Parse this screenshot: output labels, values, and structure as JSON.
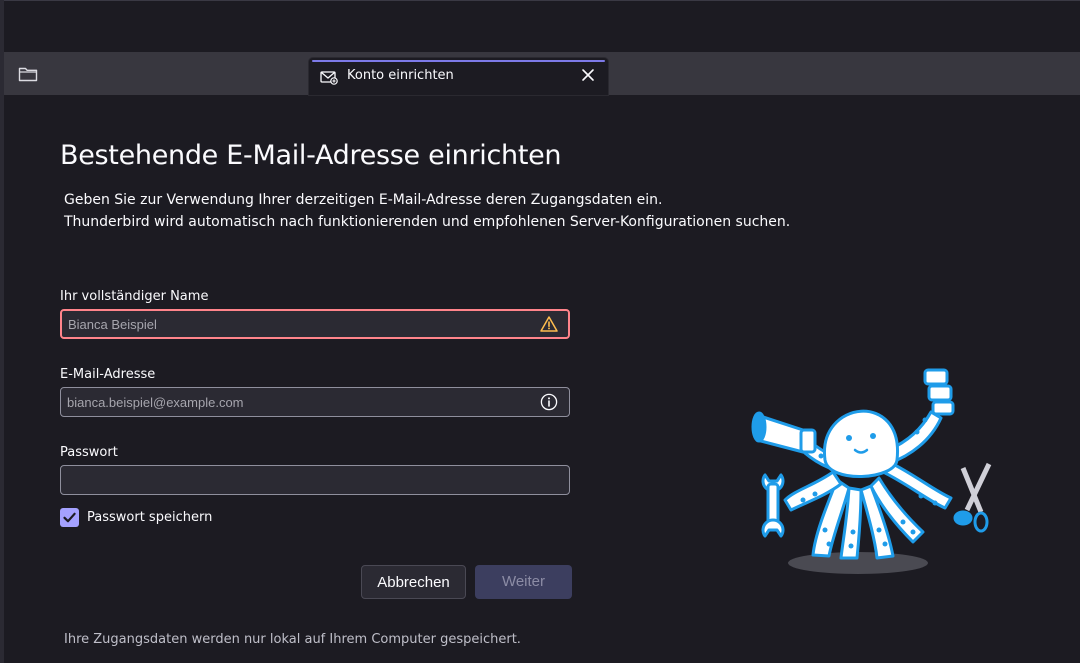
{
  "window": {
    "tab": {
      "label": "Konto einrichten",
      "icon": "mail-setup-icon",
      "accent_color": "#7d7ae8"
    },
    "folder_icon": "folder-icon"
  },
  "page": {
    "title": "Bestehende E-Mail-Adresse einrichten",
    "intro_line1": "Geben Sie zur Verwendung Ihrer derzeitigen E-Mail-Adresse deren Zugangsdaten ein.",
    "intro_line2": "Thunderbird wird automatisch nach funktionierenden und empfohlenen Server-Konfigurationen suchen."
  },
  "form": {
    "name": {
      "label": "Ihr vollständiger Name",
      "placeholder": "Bianca Beispiel",
      "value": "",
      "status_icon": "warning-icon",
      "status_color": "#ff848b"
    },
    "email": {
      "label": "E-Mail-Adresse",
      "placeholder": "bianca.beispiel@example.com",
      "value": "",
      "status_icon": "info-icon"
    },
    "password": {
      "label": "Passwort",
      "placeholder": "",
      "value": ""
    },
    "remember_password": {
      "label": "Passwort speichern",
      "checked": true
    }
  },
  "buttons": {
    "cancel": "Abbrechen",
    "next": "Weiter"
  },
  "footer": {
    "note": "Ihre Zugangsdaten werden nur lokal auf Ihrem Computer gespeichert."
  },
  "illustration": {
    "name": "octopus-mascot",
    "colors": {
      "body": "#ffffff",
      "accent": "#1f9ce9",
      "shadow": "#4a4a52"
    }
  }
}
